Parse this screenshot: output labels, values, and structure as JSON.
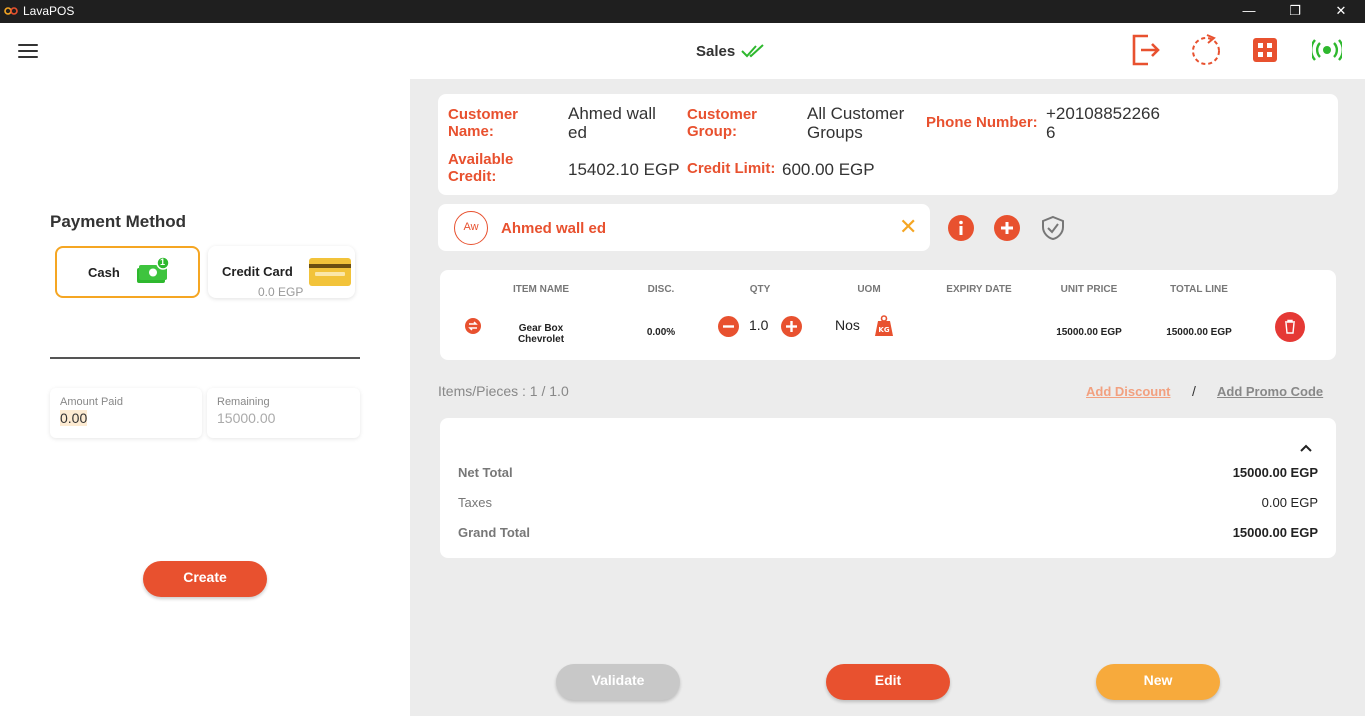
{
  "window": {
    "title": "LavaPOS",
    "minimize": "—",
    "restore": "❐",
    "close": "✕"
  },
  "header": {
    "title": "Sales"
  },
  "payment": {
    "title": "Payment Method",
    "cash_label": "Cash",
    "cash_badge": "1",
    "credit_card_label": "Credit Card",
    "credit_card_amount": "0.0 EGP",
    "amount_paid_label": "Amount Paid",
    "amount_paid_value": "0.00",
    "remaining_label": "Remaining",
    "remaining_value": "15000.00",
    "create_label": "Create"
  },
  "customer": {
    "name_label": "Customer Name:",
    "name_value_line1": "Ahmed wall",
    "name_value_line2": "ed",
    "group_label": "Customer Group:",
    "group_value_line1": "All Customer",
    "group_value_line2": "Groups",
    "phone_label": "Phone Number:",
    "phone_value_line1": "+20108852266",
    "phone_value_line2": "6",
    "credit_label_line1": "Available",
    "credit_label_line2": "Credit:",
    "credit_value": "15402.10 EGP",
    "limit_label": "Credit Limit:",
    "limit_value": "600.00 EGP",
    "avatar_initials": "Aw",
    "selected_name": "Ahmed wall ed"
  },
  "items_table": {
    "columns": [
      "ITEM NAME",
      "DISC.",
      "QTY",
      "UOM",
      "EXPIRY DATE",
      "UNIT PRICE",
      "TOTAL LINE"
    ],
    "rows": [
      {
        "name_line1": "Gear Box",
        "name_line2": "Chevrolet",
        "disc": "0.00%",
        "qty": "1.0",
        "uom": "Nos",
        "expiry": "",
        "unit_price": "15000.00 EGP",
        "total_line": "15000.00 EGP"
      }
    ]
  },
  "summary": {
    "items_pieces": "Items/Pieces : 1 / 1.0",
    "add_discount": "Add Discount",
    "separator": "/",
    "add_promo": "Add Promo Code",
    "net_total_label": "Net Total",
    "net_total_value": "15000.00 EGP",
    "taxes_label": "Taxes",
    "taxes_value": "0.00 EGP",
    "grand_total_label": "Grand Total",
    "grand_total_value": "15000.00 EGP"
  },
  "actions": {
    "validate": "Validate",
    "edit": "Edit",
    "new": "New"
  },
  "colors": {
    "accent": "#e8512f",
    "secondary": "#f5a623",
    "success": "#2eb82e",
    "panel_bg": "#ececec"
  }
}
